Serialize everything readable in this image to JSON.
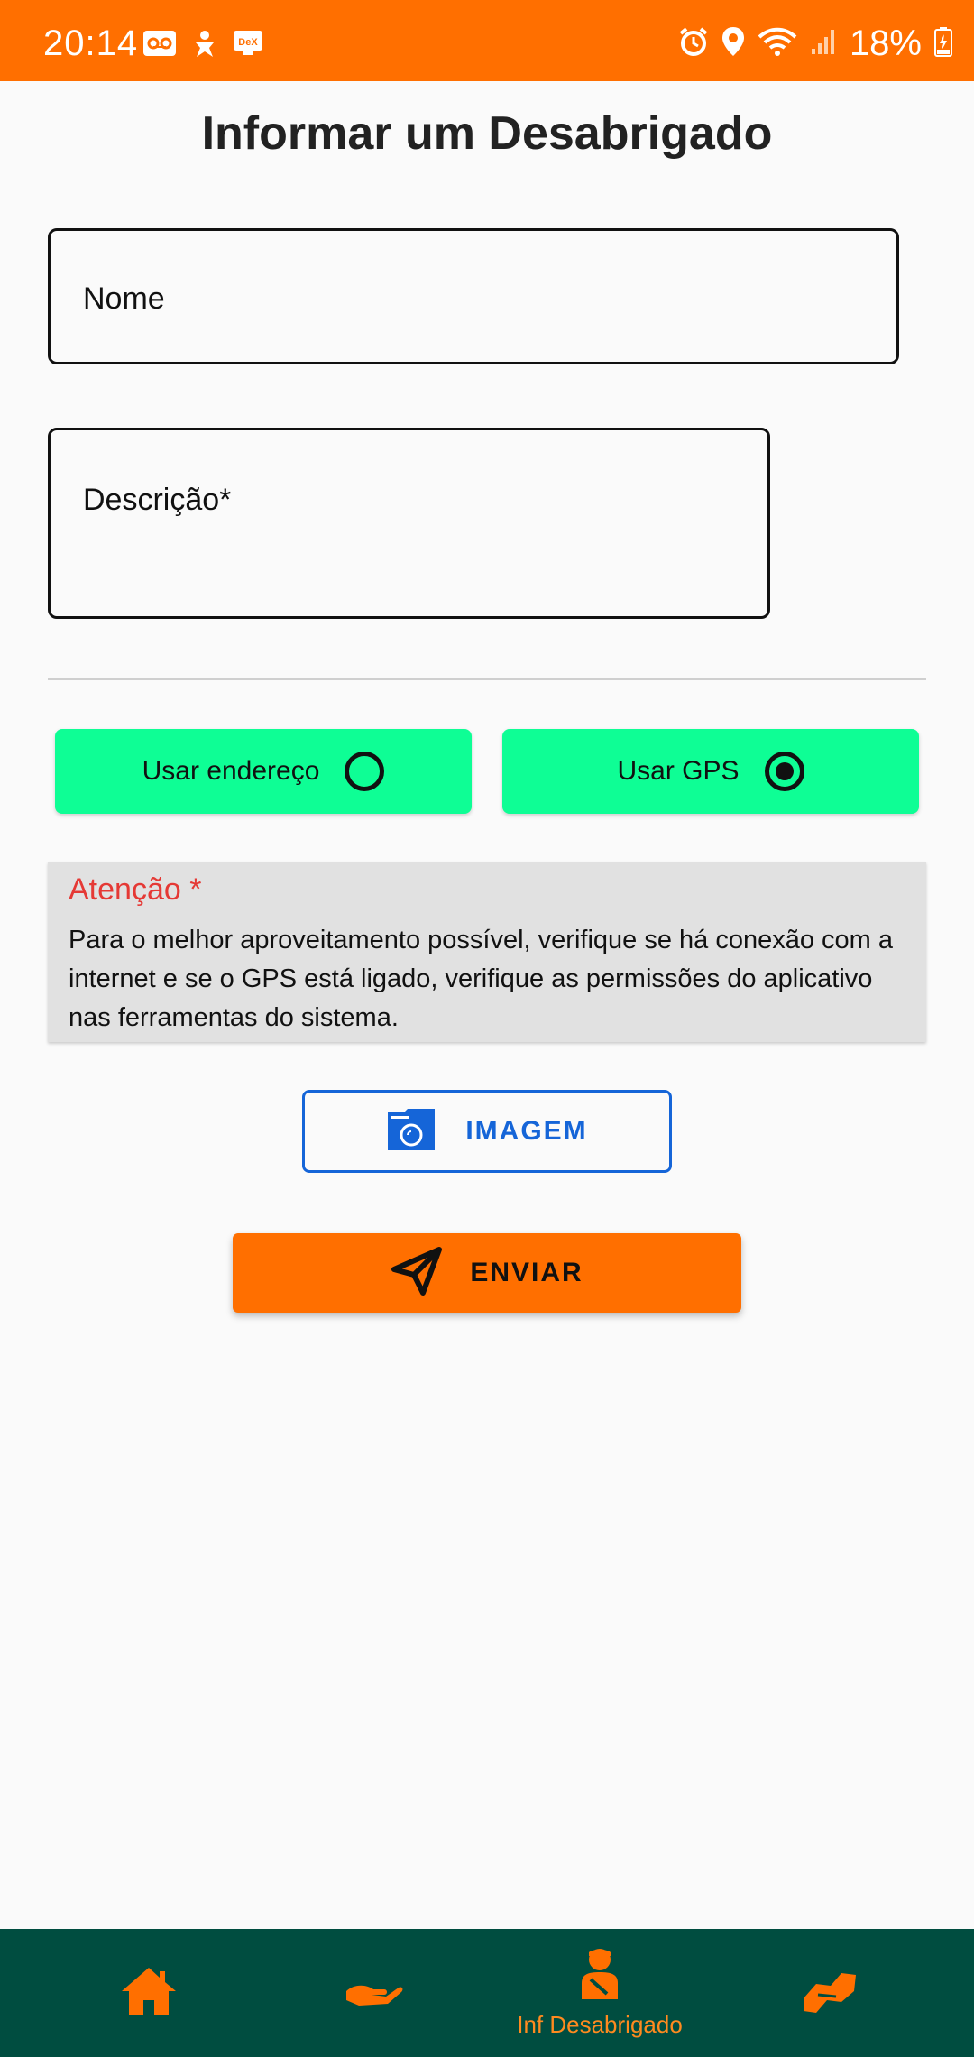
{
  "status_bar": {
    "time": "20:14",
    "battery": "18%",
    "left_icons": [
      "voicemail-icon",
      "accessibility-icon",
      "dex-icon"
    ],
    "right_icons": [
      "alarm-icon",
      "location-icon",
      "wifi-icon",
      "signal-icon",
      "battery-icon"
    ]
  },
  "page": {
    "title": "Informar um Desabrigado"
  },
  "form": {
    "nome_label": "Nome",
    "descricao_label": "Descrição*",
    "location_options": [
      {
        "label": "Usar endereço",
        "selected": false
      },
      {
        "label": "Usar GPS",
        "selected": true
      }
    ]
  },
  "notice": {
    "title": "Atenção *",
    "text": "Para o melhor aproveitamento possível, verifique se há conexão com a internet e se o GPS está ligado, verifique as permissões do aplicativo nas ferramentas do sistema."
  },
  "actions": {
    "image_label": "IMAGEM",
    "send_label": "ENVIAR"
  },
  "bottom_nav": {
    "items": [
      {
        "icon": "home-icon",
        "label": ""
      },
      {
        "icon": "donate-hand-icon",
        "label": ""
      },
      {
        "icon": "homeless-person-icon",
        "label": "Inf Desabrigado",
        "active": true
      },
      {
        "icon": "helping-hands-icon",
        "label": ""
      }
    ]
  },
  "colors": {
    "primary_orange": "#ff6f00",
    "nav_background": "#004d40",
    "toggle_green": "#0efe95",
    "attention_red": "#e53935",
    "image_blue": "#1565d8"
  }
}
